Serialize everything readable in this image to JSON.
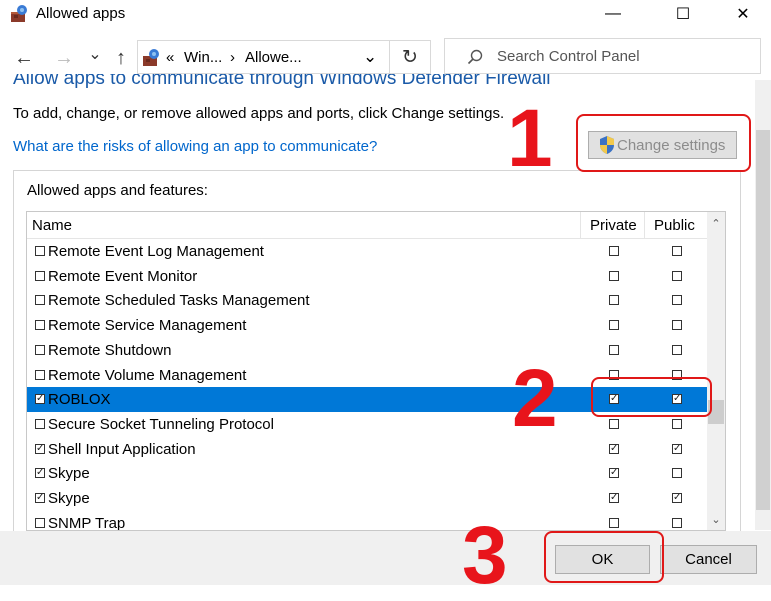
{
  "window": {
    "title": "Allowed apps",
    "minimize_glyph": "—",
    "maximize_glyph": "☐",
    "close_glyph": "✕"
  },
  "nav": {
    "back_glyph": "←",
    "forward_glyph": "→",
    "recent_glyph": "⌄",
    "up_glyph": "↑",
    "crumb_prefix": "«",
    "crumb_1": "Win...",
    "crumb_sep": "›",
    "crumb_2": "Allowe...",
    "address_dropdown_glyph": "⌄",
    "refresh_glyph": "↻",
    "search_placeholder": "Search Control Panel"
  },
  "content": {
    "heading": "Allow apps to communicate through Windows Defender Firewall",
    "instruction": "To add, change, or remove allowed apps and ports, click Change settings.",
    "risk_link": "What are the risks of allowing an app to communicate?",
    "change_settings_label": "Change settings",
    "group_label": "Allowed apps and features:"
  },
  "table": {
    "columns": [
      "Name",
      "Private",
      "Public"
    ],
    "rows": [
      {
        "name": "Remote Event Log Management",
        "enabled": false,
        "private": false,
        "public": false,
        "selected": false
      },
      {
        "name": "Remote Event Monitor",
        "enabled": false,
        "private": false,
        "public": false,
        "selected": false
      },
      {
        "name": "Remote Scheduled Tasks Management",
        "enabled": false,
        "private": false,
        "public": false,
        "selected": false
      },
      {
        "name": "Remote Service Management",
        "enabled": false,
        "private": false,
        "public": false,
        "selected": false
      },
      {
        "name": "Remote Shutdown",
        "enabled": false,
        "private": false,
        "public": false,
        "selected": false
      },
      {
        "name": "Remote Volume Management",
        "enabled": false,
        "private": false,
        "public": false,
        "selected": false
      },
      {
        "name": "ROBLOX",
        "enabled": true,
        "private": true,
        "public": true,
        "selected": true
      },
      {
        "name": "Secure Socket Tunneling Protocol",
        "enabled": false,
        "private": false,
        "public": false,
        "selected": false
      },
      {
        "name": "Shell Input Application",
        "enabled": true,
        "private": true,
        "public": true,
        "selected": false
      },
      {
        "name": "Skype",
        "enabled": true,
        "private": true,
        "public": false,
        "selected": false
      },
      {
        "name": "Skype",
        "enabled": true,
        "private": true,
        "public": true,
        "selected": false
      },
      {
        "name": "SNMP Trap",
        "enabled": false,
        "private": false,
        "public": false,
        "selected": false
      }
    ],
    "scroll_up_glyph": "⌃",
    "scroll_down_glyph": "⌄"
  },
  "footer": {
    "ok_label": "OK",
    "cancel_label": "Cancel"
  },
  "annotations": {
    "step_1": "1",
    "step_2": "2",
    "step_3": "3",
    "color": "#e8141b"
  },
  "colors": {
    "selection": "#0078d7",
    "link": "#0066cc",
    "heading": "#1a5aa8"
  }
}
